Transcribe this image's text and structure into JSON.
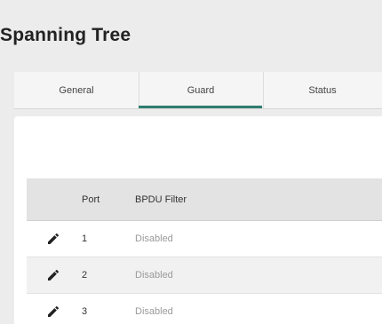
{
  "page": {
    "title": "Spanning Tree"
  },
  "tabs": [
    {
      "label": "General"
    },
    {
      "label": "Guard",
      "active": true
    },
    {
      "label": "Status"
    }
  ],
  "table": {
    "columns": {
      "port": "Port",
      "bpdu_filter": "BPDU Filter"
    },
    "rows": [
      {
        "port": "1",
        "bpdu_filter": "Disabled"
      },
      {
        "port": "2",
        "bpdu_filter": "Disabled"
      },
      {
        "port": "3",
        "bpdu_filter": "Disabled"
      }
    ]
  },
  "icons": {
    "edit": "edit-pencil-icon"
  },
  "colors": {
    "accent": "#2e7d6f"
  }
}
